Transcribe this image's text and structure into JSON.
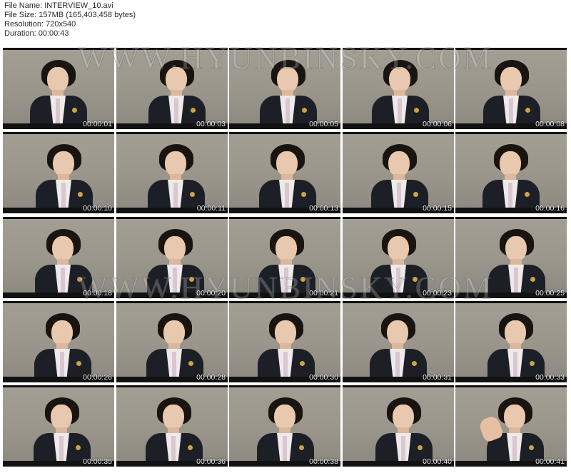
{
  "info": {
    "file_name": "File Name: INTERVIEW_10.avi",
    "file_size": "File Size: 157MB (165,403,458 bytes)",
    "resolution": "Resolution: 720x540",
    "duration": "Duration: 00:00:43"
  },
  "watermark": "WWW.HYUNBINSKY.COM",
  "thumbnails": [
    "00:00:01",
    "00:00:03",
    "00:00:05",
    "00:00:06",
    "00:00:08",
    "00:00:10",
    "00:00:11",
    "00:00:13",
    "00:00:15",
    "00:00:16",
    "00:00:18",
    "00:00:20",
    "00:00:21",
    "00:00:23",
    "00:00:25",
    "00:00:26",
    "00:00:28",
    "00:00:30",
    "00:00:31",
    "00:00:33",
    "00:00:35",
    "00:00:36",
    "00:00:38",
    "00:00:40",
    "00:00:41"
  ]
}
